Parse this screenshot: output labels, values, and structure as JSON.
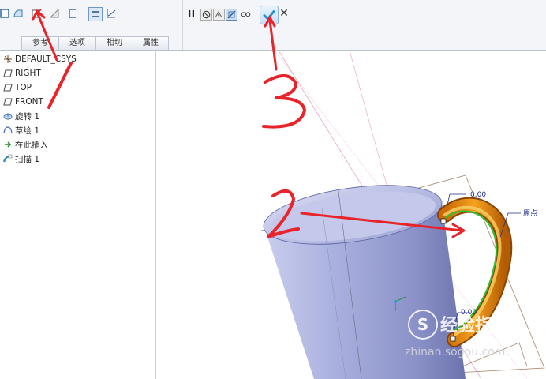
{
  "ribbon": {
    "tabs": [
      "参考",
      "选项",
      "相切",
      "属性"
    ]
  },
  "tree": {
    "items": [
      {
        "label": "DEFAULT_CSYS",
        "icon": "csys-icon"
      },
      {
        "label": "RIGHT",
        "icon": "datum-plane-icon"
      },
      {
        "label": "TOP",
        "icon": "datum-plane-icon"
      },
      {
        "label": "FRONT",
        "icon": "datum-plane-icon"
      },
      {
        "label": "旋转 1",
        "icon": "revolve-icon"
      },
      {
        "label": "草绘 1",
        "icon": "sketch-icon"
      },
      {
        "label": "在此插入",
        "icon": "insert-here-arrow-icon"
      },
      {
        "label": "扫描 1",
        "icon": "sweep-icon"
      }
    ]
  },
  "viewport": {
    "dim_top": "0.00",
    "dim_bottom": "0.00",
    "origin_label": "原点"
  },
  "annotations": {
    "one": "1",
    "two": "2",
    "three": "3",
    "color": "#e8242a"
  },
  "watermark": {
    "cn": "经验指南",
    "en": "zhinan.sogou.com",
    "logo": "S"
  },
  "colors": {
    "handle": "#e98a12",
    "trajectory": "#2fbf3a",
    "cup_body": "#9fa6d6",
    "confirm_check": "#1f8fd8"
  }
}
